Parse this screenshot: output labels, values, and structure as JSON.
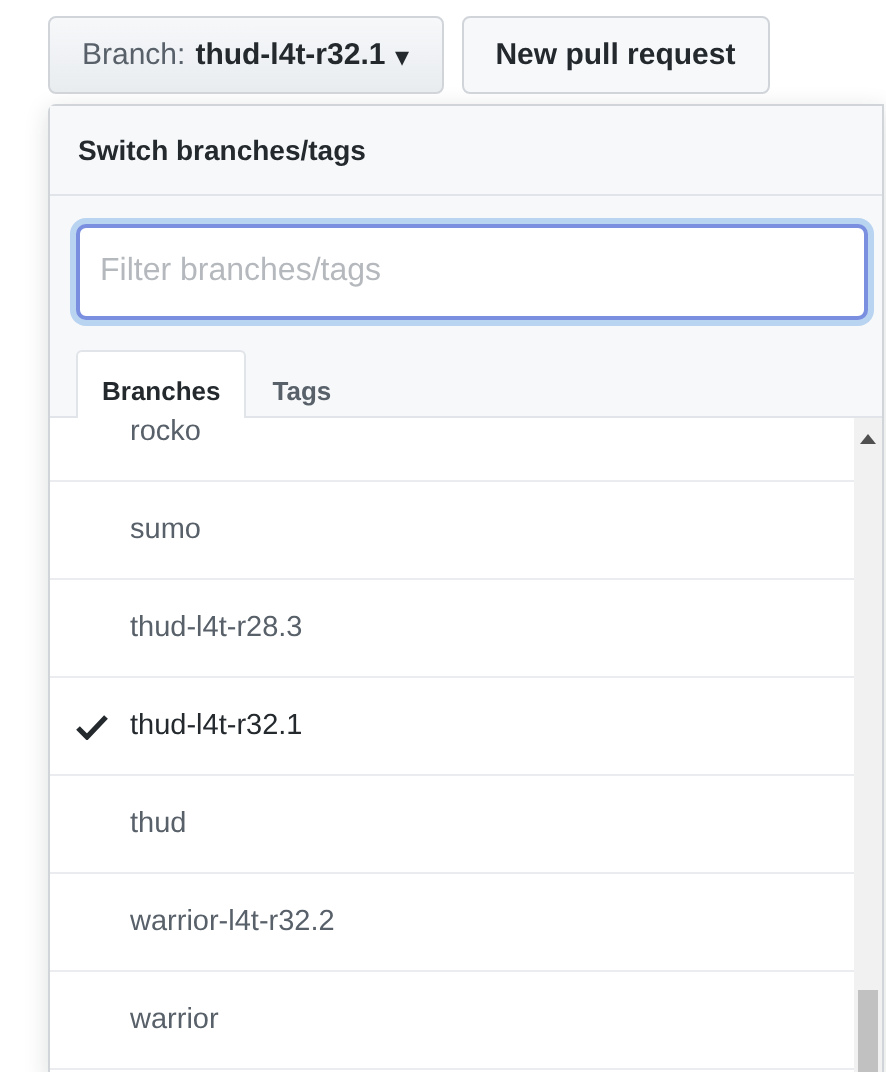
{
  "branch_button": {
    "label": "Branch:",
    "value": "thud-l4t-r32.1",
    "caret": "▾"
  },
  "pull_request_button": {
    "label": "New pull request"
  },
  "dropdown": {
    "title": "Switch branches/tags",
    "filter": {
      "placeholder": "Filter branches/tags"
    },
    "tabs": [
      {
        "label": "Branches",
        "selected": true
      },
      {
        "label": "Tags",
        "selected": false
      }
    ],
    "branches": [
      {
        "name": "rocko",
        "selected": false
      },
      {
        "name": "sumo",
        "selected": false
      },
      {
        "name": "thud-l4t-r28.3",
        "selected": false
      },
      {
        "name": "thud-l4t-r32.1",
        "selected": true
      },
      {
        "name": "thud",
        "selected": false
      },
      {
        "name": "warrior-l4t-r32.2",
        "selected": false
      },
      {
        "name": "warrior",
        "selected": false
      }
    ]
  }
}
